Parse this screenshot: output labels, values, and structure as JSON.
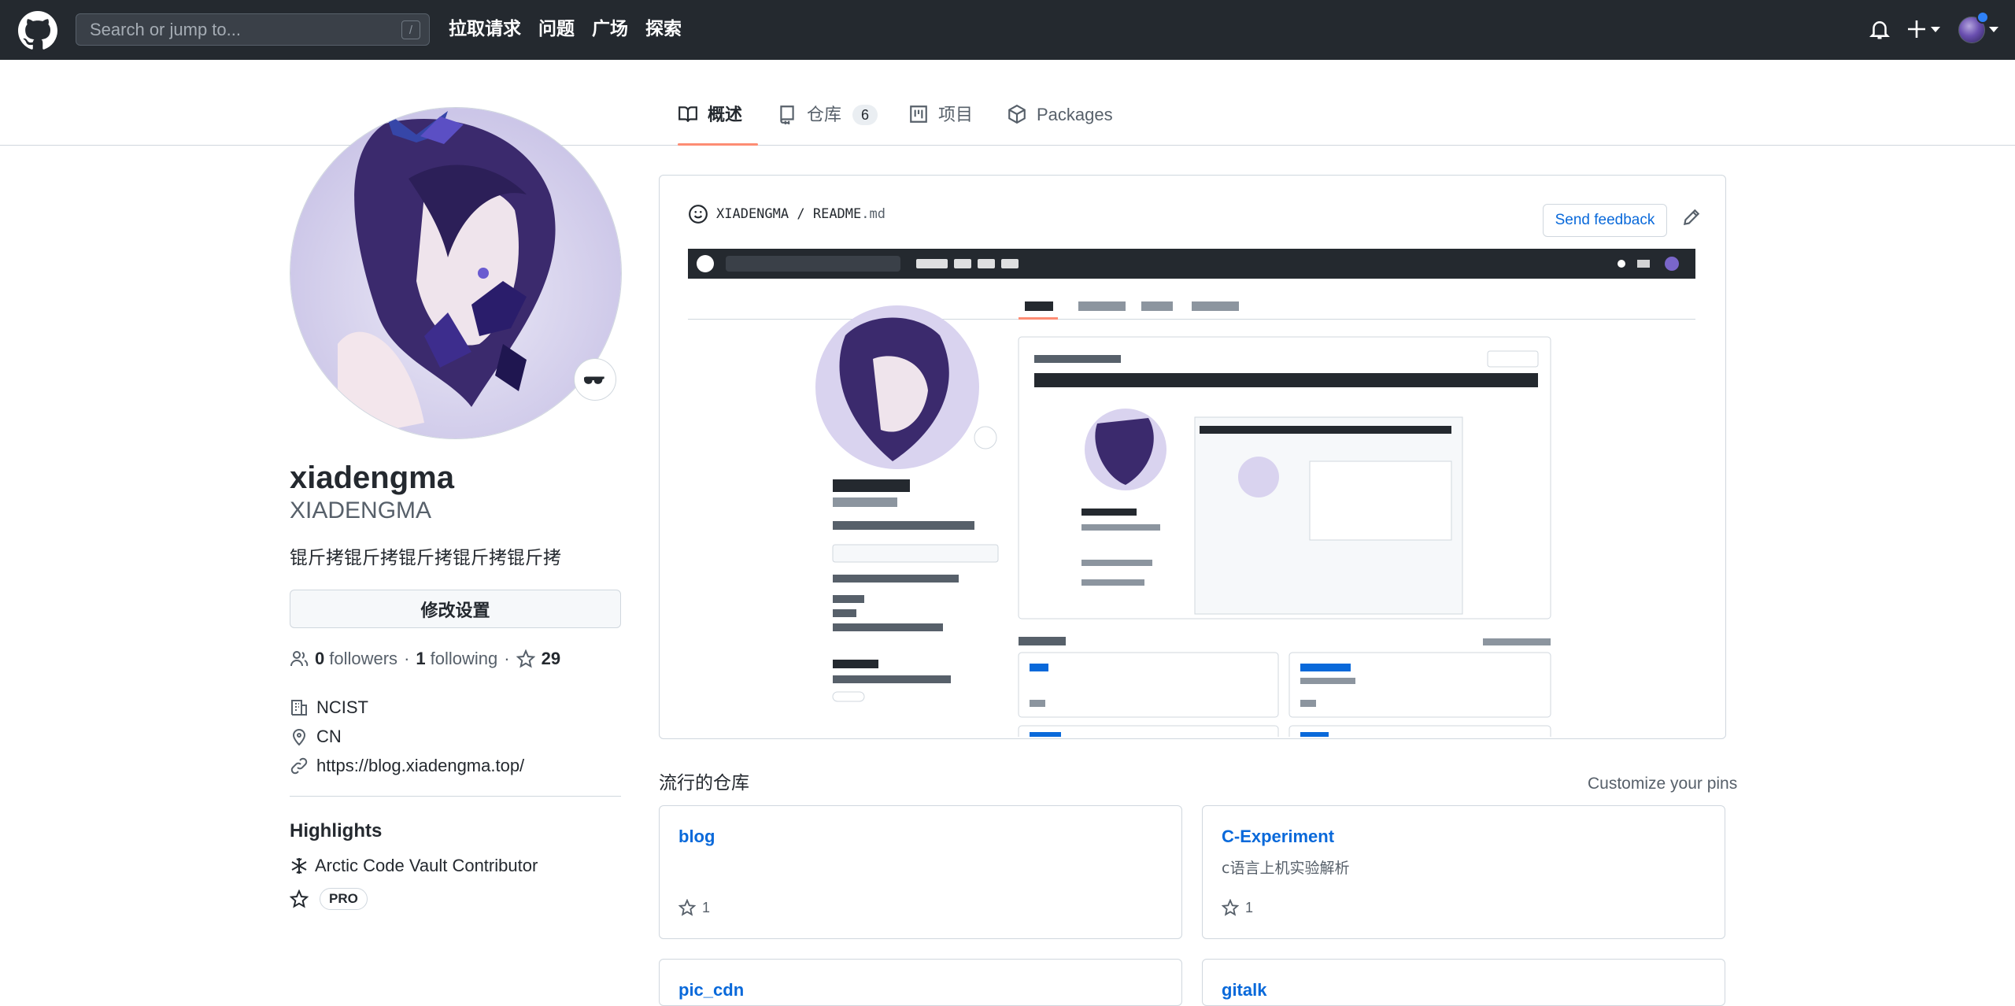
{
  "header": {
    "search_placeholder": "Search or jump to...",
    "search_shortcut": "/",
    "nav": [
      "拉取请求",
      "问题",
      "广场",
      "探索"
    ]
  },
  "tabs": [
    {
      "label": "概述",
      "icon": "book-icon",
      "active": true
    },
    {
      "label": "仓库",
      "icon": "repo-icon",
      "count": "6"
    },
    {
      "label": "项目",
      "icon": "project-icon"
    },
    {
      "label": "Packages",
      "icon": "package-icon"
    }
  ],
  "profile": {
    "name": "xiadengma",
    "login": "XIADENGMA",
    "bio": "锟斤拷锟斤拷锟斤拷锟斤拷锟斤拷",
    "edit_label": "修改设置",
    "followers_count": "0",
    "followers_label": "followers",
    "following_count": "1",
    "following_label": "following",
    "stars_count": "29",
    "company": "NCIST",
    "location": "CN",
    "website": "https://blog.xiadengma.top/"
  },
  "highlights": {
    "title": "Highlights",
    "items": [
      "Arctic Code Vault Contributor"
    ],
    "pro_label": "PRO"
  },
  "readme": {
    "owner": "XIADENGMA",
    "separator": " / ",
    "file": "README",
    "ext": ".md",
    "feedback_label": "Send feedback"
  },
  "pinned": {
    "title": "流行的仓库",
    "customize_label": "Customize your pins",
    "repos": [
      {
        "name": "blog",
        "description": "",
        "stars": "1"
      },
      {
        "name": "C-Experiment",
        "description": "c语言上机实验解析",
        "stars": "1"
      },
      {
        "name": "pic_cdn",
        "description": "",
        "stars": ""
      },
      {
        "name": "gitalk",
        "description": "",
        "stars": ""
      }
    ]
  },
  "colors": {
    "header_bg": "#24292f",
    "link": "#0969da",
    "tab_underline": "#fd8c73",
    "notification_dot": "#2f81f7"
  }
}
